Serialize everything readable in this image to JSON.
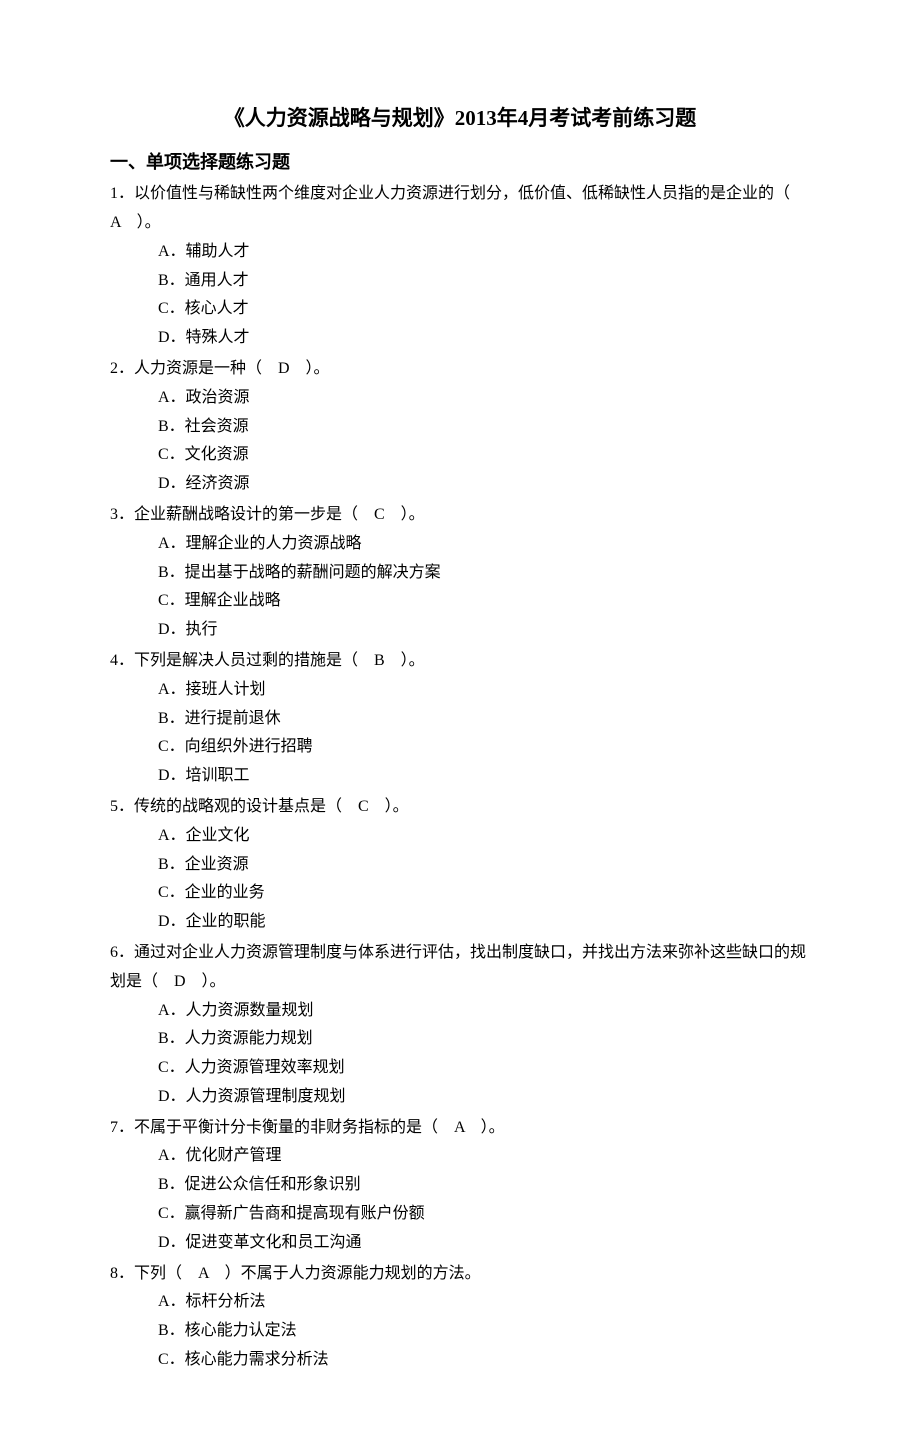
{
  "title": "《人力资源战略与规划》2013年4月考试考前练习题",
  "section_header": "一、单项选择题练习题",
  "questions": [
    {
      "text": "1．以价值性与稀缺性两个维度对企业人力资源进行划分，低价值、低稀缺性人员指的是企业的（　A　）。",
      "options": [
        "A．辅助人才",
        "B．通用人才",
        "C．核心人才",
        "D．特殊人才"
      ]
    },
    {
      "text": "2．人力资源是一种（　D　）。",
      "options": [
        "A．政治资源",
        "B．社会资源",
        "C．文化资源",
        "D．经济资源"
      ]
    },
    {
      "text": "3．企业薪酬战略设计的第一步是（　C　）。",
      "options": [
        "A．理解企业的人力资源战略",
        "B．提出基于战略的薪酬问题的解决方案",
        "C．理解企业战略",
        "D．执行"
      ]
    },
    {
      "text": "4．下列是解决人员过剩的措施是（　B　）。",
      "options": [
        "A．接班人计划",
        "B．进行提前退休",
        "C．向组织外进行招聘",
        "D．培训职工"
      ]
    },
    {
      "text": "5．传统的战略观的设计基点是（　C　）。",
      "options": [
        "A．企业文化",
        "B．企业资源",
        "C．企业的业务",
        "D．企业的职能"
      ]
    },
    {
      "text": "6．通过对企业人力资源管理制度与体系进行评估，找出制度缺口，并找出方法来弥补这些缺口的规划是（　D　）。",
      "options": [
        "A．人力资源数量规划",
        "B．人力资源能力规划",
        "C．人力资源管理效率规划",
        "D．人力资源管理制度规划"
      ]
    },
    {
      "text": "7．不属于平衡计分卡衡量的非财务指标的是（　A　）。",
      "options": [
        "A．优化财产管理",
        "B．促进公众信任和形象识别",
        "C．赢得新广告商和提高现有账户份额",
        "D．促进变革文化和员工沟通"
      ]
    },
    {
      "text": "8．下列（　A　）不属于人力资源能力规划的方法。",
      "options": [
        "A．标杆分析法",
        "B．核心能力认定法",
        "C．核心能力需求分析法"
      ]
    }
  ]
}
